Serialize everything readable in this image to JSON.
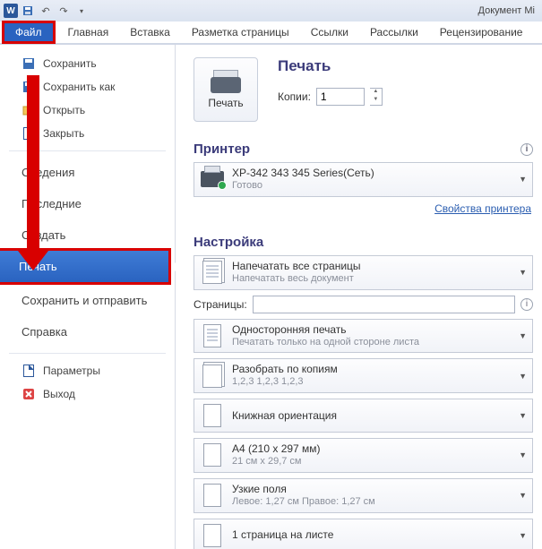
{
  "titlebar": {
    "doc_title": "Документ Mi"
  },
  "ribbon": {
    "file": "Файл",
    "tabs": [
      "Главная",
      "Вставка",
      "Разметка страницы",
      "Ссылки",
      "Рассылки",
      "Рецензирование"
    ]
  },
  "sidebar": {
    "save": "Сохранить",
    "save_as": "Сохранить как",
    "open": "Открыть",
    "close": "Закрыть",
    "info": "Сведения",
    "recent": "Последние",
    "new": "Создать",
    "print": "Печать",
    "share": "Сохранить и отправить",
    "help": "Справка",
    "options": "Параметры",
    "exit": "Выход"
  },
  "print": {
    "button_label": "Печать",
    "heading": "Печать",
    "copies_label": "Копии:",
    "copies_value": "1",
    "printer_heading": "Принтер",
    "printer_name": "XP-342 343 345 Series(Сеть)",
    "printer_status": "Готово",
    "printer_props": "Свойства принтера",
    "settings_heading": "Настройка",
    "opt_allpages_title": "Напечатать все страницы",
    "opt_allpages_sub": "Напечатать весь документ",
    "pages_label": "Страницы:",
    "opt_oneside_title": "Односторонняя печать",
    "opt_oneside_sub": "Печатать только на одной стороне листа",
    "opt_collate_title": "Разобрать по копиям",
    "opt_collate_sub": "1,2,3    1,2,3    1,2,3",
    "opt_orient_title": "Книжная ориентация",
    "opt_paper_title": "A4 (210 x 297 мм)",
    "opt_paper_sub": "21 см x 29,7 см",
    "opt_margins_title": "Узкие поля",
    "opt_margins_sub": "Левое: 1,27 см   Правое: 1,27 см",
    "opt_pps_title": "1 страница на листе"
  }
}
